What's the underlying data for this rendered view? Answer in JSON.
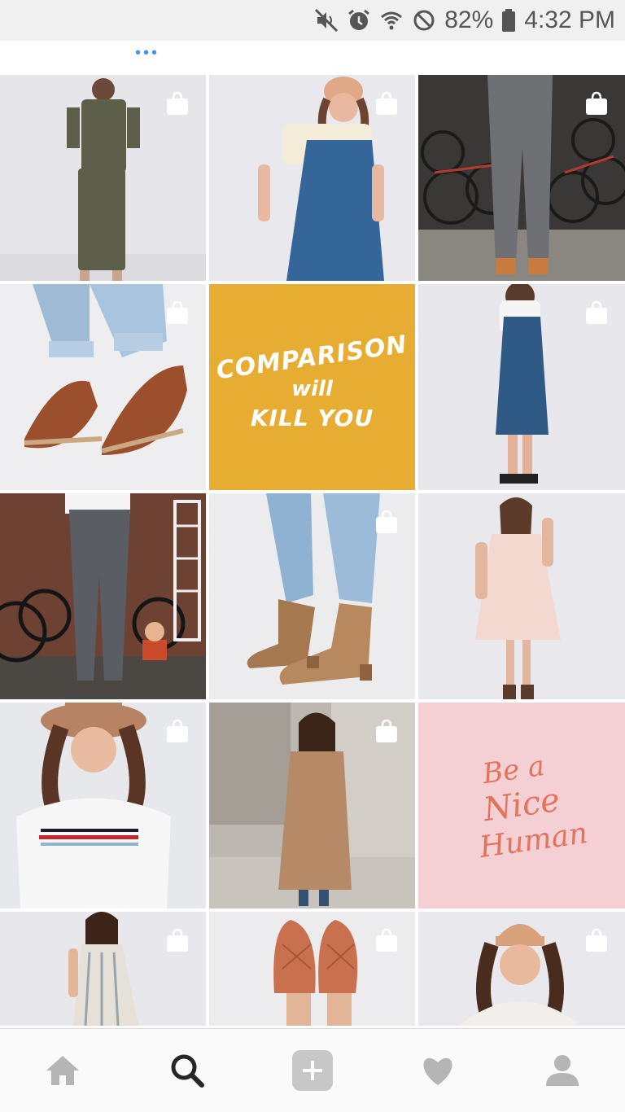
{
  "status_bar": {
    "battery_percent": "82%",
    "time": "4:32 PM",
    "icons": [
      "mute-icon",
      "alarm-icon",
      "wifi-icon",
      "no-disturb-icon",
      "battery-icon"
    ]
  },
  "grid": {
    "tiles": [
      {
        "type": "photo",
        "subject": "olive jumpsuit model",
        "shoppable": true
      },
      {
        "type": "photo",
        "subject": "denim overall dress model",
        "shoppable": true
      },
      {
        "type": "photo",
        "subject": "grey jeans with bicycles",
        "shoppable": true
      },
      {
        "type": "photo",
        "subject": "brown leather sandals",
        "shoppable": true
      },
      {
        "type": "quote",
        "lines": [
          "COMPARISON",
          "will",
          "KILL YOU"
        ],
        "bg": "#e6ad32",
        "shoppable": false
      },
      {
        "type": "photo",
        "subject": "denim dress model side",
        "shoppable": true
      },
      {
        "type": "photo",
        "subject": "jeans back view with bicycles",
        "shoppable": false
      },
      {
        "type": "photo",
        "subject": "tan ankle boots",
        "shoppable": true
      },
      {
        "type": "photo",
        "subject": "pink floral dress model",
        "shoppable": false
      },
      {
        "type": "photo",
        "subject": "striped tee with hat",
        "shoppable": true
      },
      {
        "type": "photo",
        "subject": "camel coat street",
        "shoppable": true
      },
      {
        "type": "quote",
        "lines": [
          "Be a",
          "Nice",
          "Human"
        ],
        "bg": "#f4cfd3",
        "shoppable": false
      },
      {
        "type": "photo",
        "subject": "striped sleeveless dress",
        "shoppable": true
      },
      {
        "type": "photo",
        "subject": "terracotta mules",
        "shoppable": true
      },
      {
        "type": "photo",
        "subject": "beanie model",
        "shoppable": true
      }
    ]
  },
  "bottom_nav": {
    "items": [
      {
        "name": "home",
        "icon": "home-icon",
        "active": false
      },
      {
        "name": "search",
        "icon": "search-icon",
        "active": true
      },
      {
        "name": "add",
        "icon": "add-post-icon",
        "active": false
      },
      {
        "name": "activity",
        "icon": "heart-icon",
        "active": false
      },
      {
        "name": "profile",
        "icon": "profile-icon",
        "active": false
      }
    ]
  },
  "colors": {
    "accent": "#3897f0",
    "quote_yellow": "#e6ad32",
    "quote_pink": "#f4cfd3",
    "pink_text": "#e2735d"
  }
}
